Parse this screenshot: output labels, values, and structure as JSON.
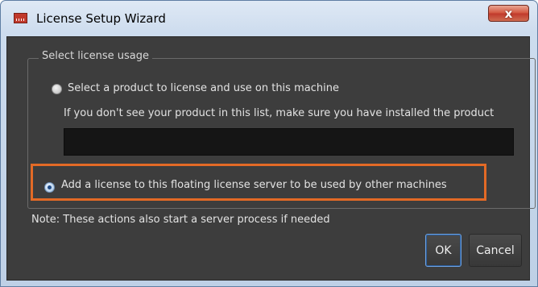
{
  "window": {
    "title": "License Setup Wizard",
    "close_label": "x"
  },
  "group": {
    "legend": "Select license usage"
  },
  "options": {
    "product": {
      "label": "Select a product to license and use on this machine",
      "hint": "If you don't see your product in this list, make sure you have installed the product",
      "selected": false
    },
    "floating": {
      "label": "Add a license to this floating license server to be used by other machines",
      "selected": true
    }
  },
  "note": "Note: These actions also start a server process if needed",
  "buttons": {
    "ok": "OK",
    "cancel": "Cancel"
  },
  "colors": {
    "highlight": "#e36a26",
    "panel": "#3d3d3d",
    "list_background": "#151515"
  }
}
